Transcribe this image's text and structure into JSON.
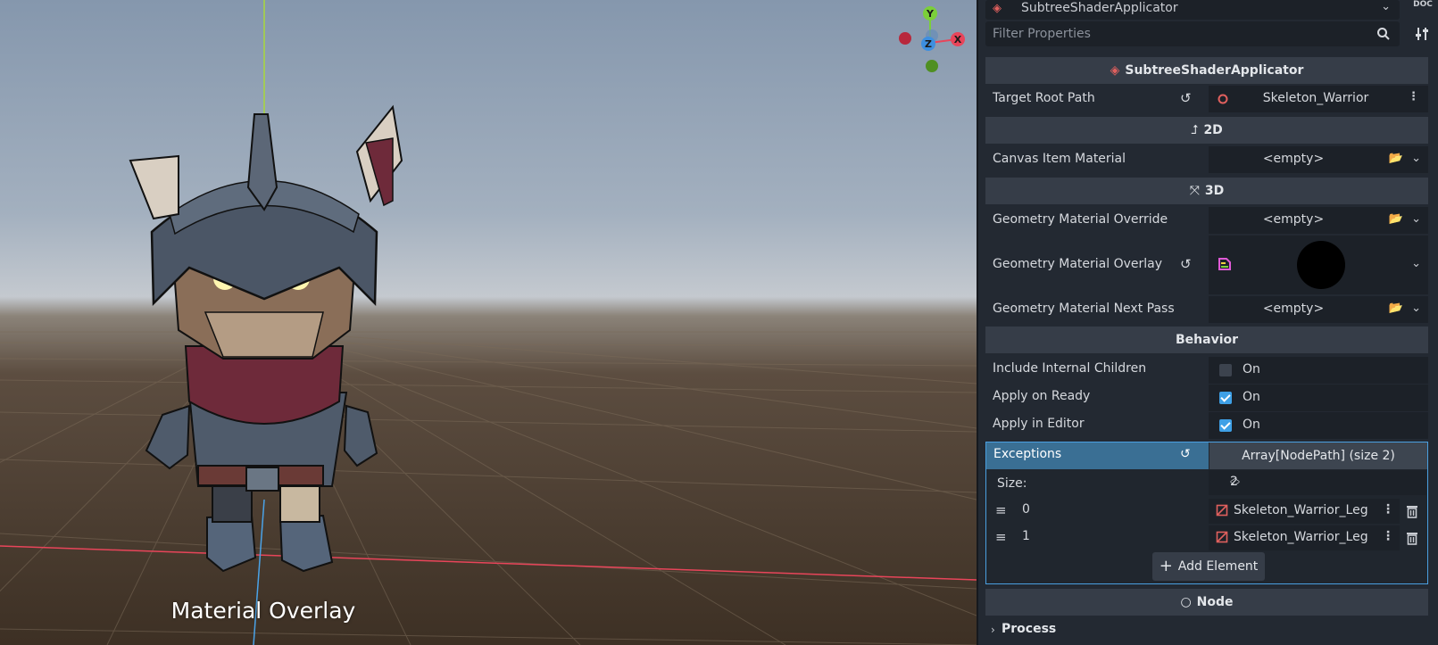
{
  "viewport": {
    "overlay_caption": "Material Overlay",
    "gizmo": {
      "y_label": "Y",
      "x_label": "X",
      "z_label": "Z"
    }
  },
  "inspector": {
    "object_selector": {
      "title": "SubtreeShaderApplicator",
      "icon": "layers-icon"
    },
    "doc_button": "DOC",
    "filter": {
      "placeholder": "Filter Properties",
      "value": ""
    },
    "class_header": "SubtreeShaderApplicator",
    "target_root_path": {
      "label": "Target Root Path",
      "value": "Skeleton_Warrior"
    },
    "section_2d": "2D",
    "canvas_item_material": {
      "label": "Canvas Item Material",
      "value": "<empty>"
    },
    "section_3d": "3D",
    "geometry_material_override": {
      "label": "Geometry Material Override",
      "value": "<empty>"
    },
    "geometry_material_overlay": {
      "label": "Geometry Material Overlay"
    },
    "geometry_material_next_pass": {
      "label": "Geometry Material Next Pass",
      "value": "<empty>"
    },
    "section_behavior": "Behavior",
    "include_internal_children": {
      "label": "Include Internal Children",
      "checked": false,
      "state_text": "On"
    },
    "apply_on_ready": {
      "label": "Apply on Ready",
      "checked": true,
      "state_text": "On"
    },
    "apply_in_editor": {
      "label": "Apply in Editor",
      "checked": true,
      "state_text": "On"
    },
    "exceptions": {
      "label": "Exceptions",
      "array_button": "Array[NodePath] (size 2)",
      "size_label": "Size:",
      "size_value": "2",
      "elements": [
        {
          "index": "0",
          "path": "Skeleton_Warrior_Leg"
        },
        {
          "index": "1",
          "path": "Skeleton_Warrior_Leg"
        }
      ],
      "add_element": "Add Element"
    },
    "section_node": "Node",
    "process": "Process"
  },
  "colors": {
    "accent": "#4a9fe0",
    "selected_row": "#3a6f94",
    "checkbox_on": "#3ea0e6",
    "axis_x": "#e8455a",
    "axis_y": "#7bcf3a",
    "axis_z": "#3d8fe0"
  }
}
